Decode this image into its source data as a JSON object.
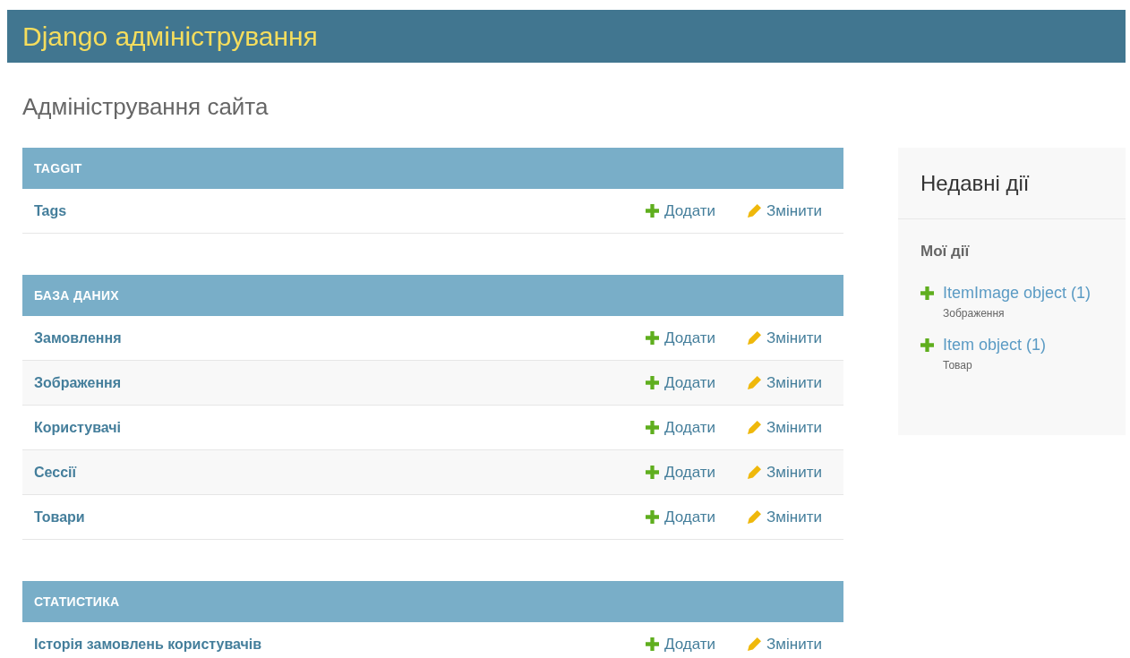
{
  "header": {
    "title": "Django адміністрування"
  },
  "page_title": "Адміністрування сайта",
  "modules": [
    {
      "caption": "TAGGIT",
      "rows": [
        {
          "name": "Tags",
          "add": "Додати",
          "change": "Змінити"
        }
      ]
    },
    {
      "caption": "БАЗА ДАНИХ",
      "rows": [
        {
          "name": "Замовлення",
          "add": "Додати",
          "change": "Змінити"
        },
        {
          "name": "Зображення",
          "add": "Додати",
          "change": "Змінити"
        },
        {
          "name": "Користувачі",
          "add": "Додати",
          "change": "Змінити"
        },
        {
          "name": "Сессії",
          "add": "Додати",
          "change": "Змінити"
        },
        {
          "name": "Товари",
          "add": "Додати",
          "change": "Змінити"
        }
      ]
    },
    {
      "caption": "СТАТИСТИКА",
      "rows": [
        {
          "name": "Історія замовлень користувачів",
          "add": "Додати",
          "change": "Змінити"
        }
      ]
    }
  ],
  "recent_actions": {
    "title": "Недавні дії",
    "subtitle": "Мої дії",
    "items": [
      {
        "kind": "addition",
        "object": "ItemImage object (1)",
        "model": "Зображення"
      },
      {
        "kind": "addition",
        "object": "Item object (1)",
        "model": "Товар"
      }
    ]
  }
}
